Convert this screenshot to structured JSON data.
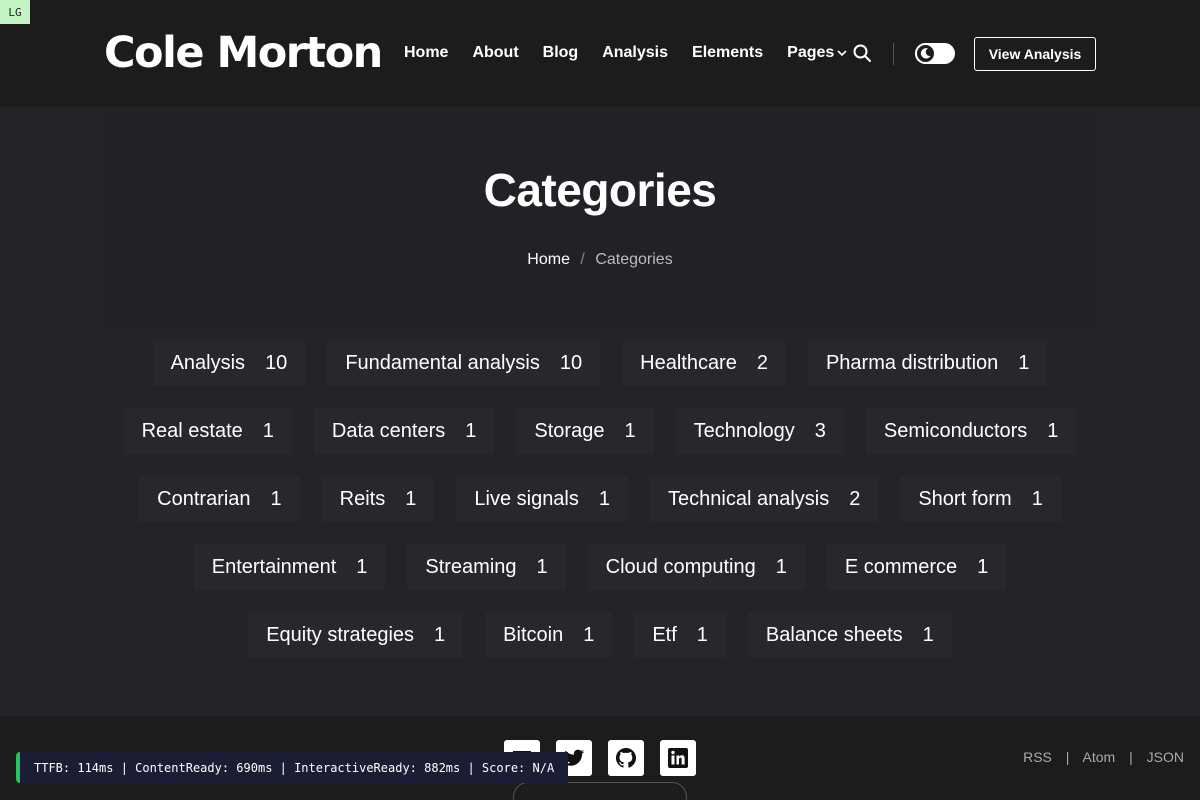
{
  "badge": "LG",
  "site": {
    "logo": "Cole Morton"
  },
  "nav": {
    "items": [
      "Home",
      "About",
      "Blog",
      "Analysis",
      "Elements"
    ],
    "pages_label": "Pages",
    "cta_label": "View Analysis"
  },
  "hero": {
    "title": "Categories",
    "breadcrumb": {
      "home": "Home",
      "separator": "/",
      "current": "Categories"
    }
  },
  "categories": [
    {
      "name": "Analysis",
      "count": "10"
    },
    {
      "name": "Fundamental analysis",
      "count": "10"
    },
    {
      "name": "Healthcare",
      "count": "2"
    },
    {
      "name": "Pharma distribution",
      "count": "1"
    },
    {
      "name": "Real estate",
      "count": "1"
    },
    {
      "name": "Data centers",
      "count": "1"
    },
    {
      "name": "Storage",
      "count": "1"
    },
    {
      "name": "Technology",
      "count": "3"
    },
    {
      "name": "Semiconductors",
      "count": "1"
    },
    {
      "name": "Contrarian",
      "count": "1"
    },
    {
      "name": "Reits",
      "count": "1"
    },
    {
      "name": "Live signals",
      "count": "1"
    },
    {
      "name": "Technical analysis",
      "count": "2"
    },
    {
      "name": "Short form",
      "count": "1"
    },
    {
      "name": "Entertainment",
      "count": "1"
    },
    {
      "name": "Streaming",
      "count": "1"
    },
    {
      "name": "Cloud computing",
      "count": "1"
    },
    {
      "name": "E commerce",
      "count": "1"
    },
    {
      "name": "Equity strategies",
      "count": "1"
    },
    {
      "name": "Bitcoin",
      "count": "1"
    },
    {
      "name": "Etf",
      "count": "1"
    },
    {
      "name": "Balance sheets",
      "count": "1"
    }
  ],
  "footer": {
    "social_icons": [
      "menu-icon",
      "twitter-icon",
      "github-icon",
      "linkedin-icon"
    ],
    "feeds": [
      "RSS",
      "Atom",
      "JSON"
    ],
    "feed_separator": "|"
  },
  "perf": {
    "text": "TTFB: 114ms | ContentReady: 690ms | InteractiveReady: 882ms | Score: N/A"
  },
  "colors": {
    "background": "#242428",
    "header": "#1c1c1c",
    "tag_bg": "#28282c",
    "perf_accent": "#22c55e"
  }
}
